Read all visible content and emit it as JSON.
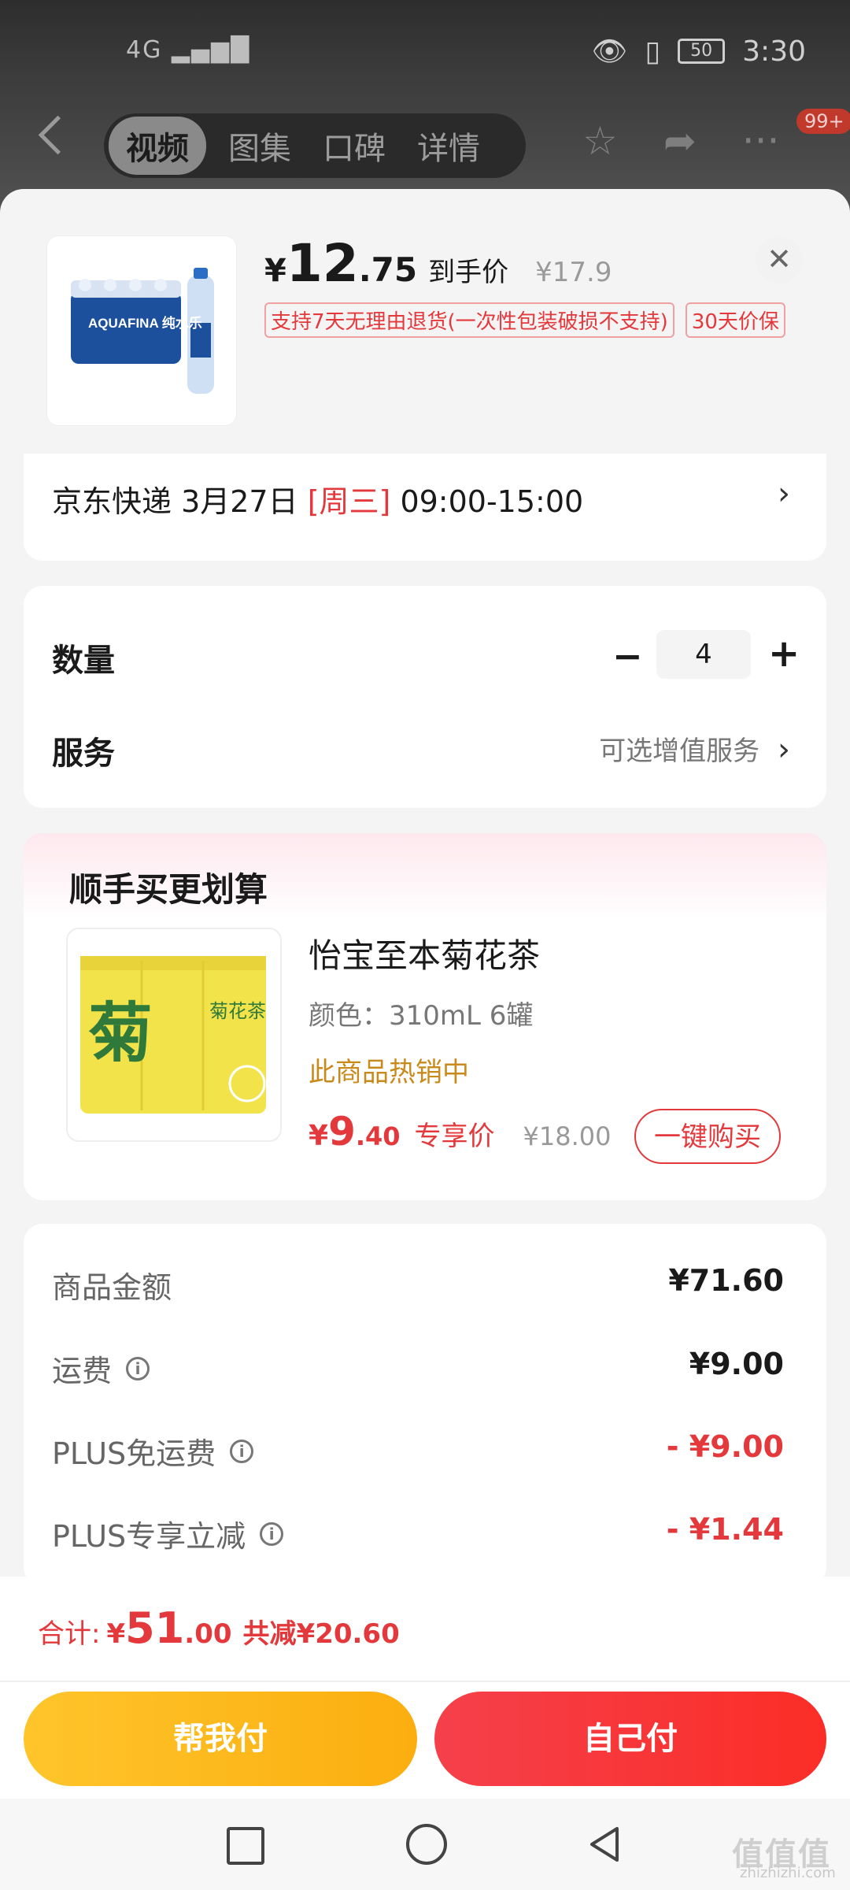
{
  "status_bar": {
    "signal": "4G",
    "battery": "50",
    "time": "3:30"
  },
  "nav": {
    "tabs": [
      "视频",
      "图集",
      "口碑",
      "详情"
    ],
    "active_tab": 0,
    "badge": "99+"
  },
  "product": {
    "price_yen": "¥",
    "price_int": "12",
    "price_dec": ".75",
    "price_label": "到手价",
    "original_price": "¥17.9",
    "tags": [
      "支持7天无理由退货(一次性包装破损不支持)",
      "30天价保"
    ],
    "image_text": "AQUAFINA 纯水乐"
  },
  "delivery": {
    "carrier_date": "京东快递 3月27日 ",
    "weekday": "[周三]",
    "window": " 09:00-15:00"
  },
  "quantity": {
    "label": "数量",
    "value": "4"
  },
  "service": {
    "label": "服务",
    "hint": "可选增值服务"
  },
  "upsell": {
    "title": "顺手买更划算",
    "name": "怡宝至本菊花茶",
    "spec": "颜色：310mL 6罐",
    "hot": "此商品热销中",
    "price_yen": "¥",
    "price_int": "9",
    "price_dec": ".40",
    "price_label": "专享价",
    "original_price": "¥18.00",
    "buy_label": "一键购买",
    "image_text": "菊花茶"
  },
  "summary": [
    {
      "label": "商品金额",
      "value": "¥71.60",
      "info": false,
      "discount": false
    },
    {
      "label": "运费",
      "value": "¥9.00",
      "info": true,
      "discount": false
    },
    {
      "label": "PLUS免运费",
      "value": "- ¥9.00",
      "info": true,
      "discount": true
    },
    {
      "label": "PLUS专享立减",
      "value": "- ¥1.44",
      "info": true,
      "discount": true
    }
  ],
  "total": {
    "label": "合计:",
    "yen": "¥",
    "int": "51",
    "dec": ".00",
    "saved": "共减¥20.60"
  },
  "actions": {
    "help_pay": "帮我付",
    "self_pay": "自己付"
  },
  "watermark": {
    "main": "值值值",
    "sub": "zhizhizhi.com"
  },
  "colors": {
    "accent_red": "#e4393c",
    "gold": "#fcae0f",
    "hot_orange": "#c98a1b"
  }
}
